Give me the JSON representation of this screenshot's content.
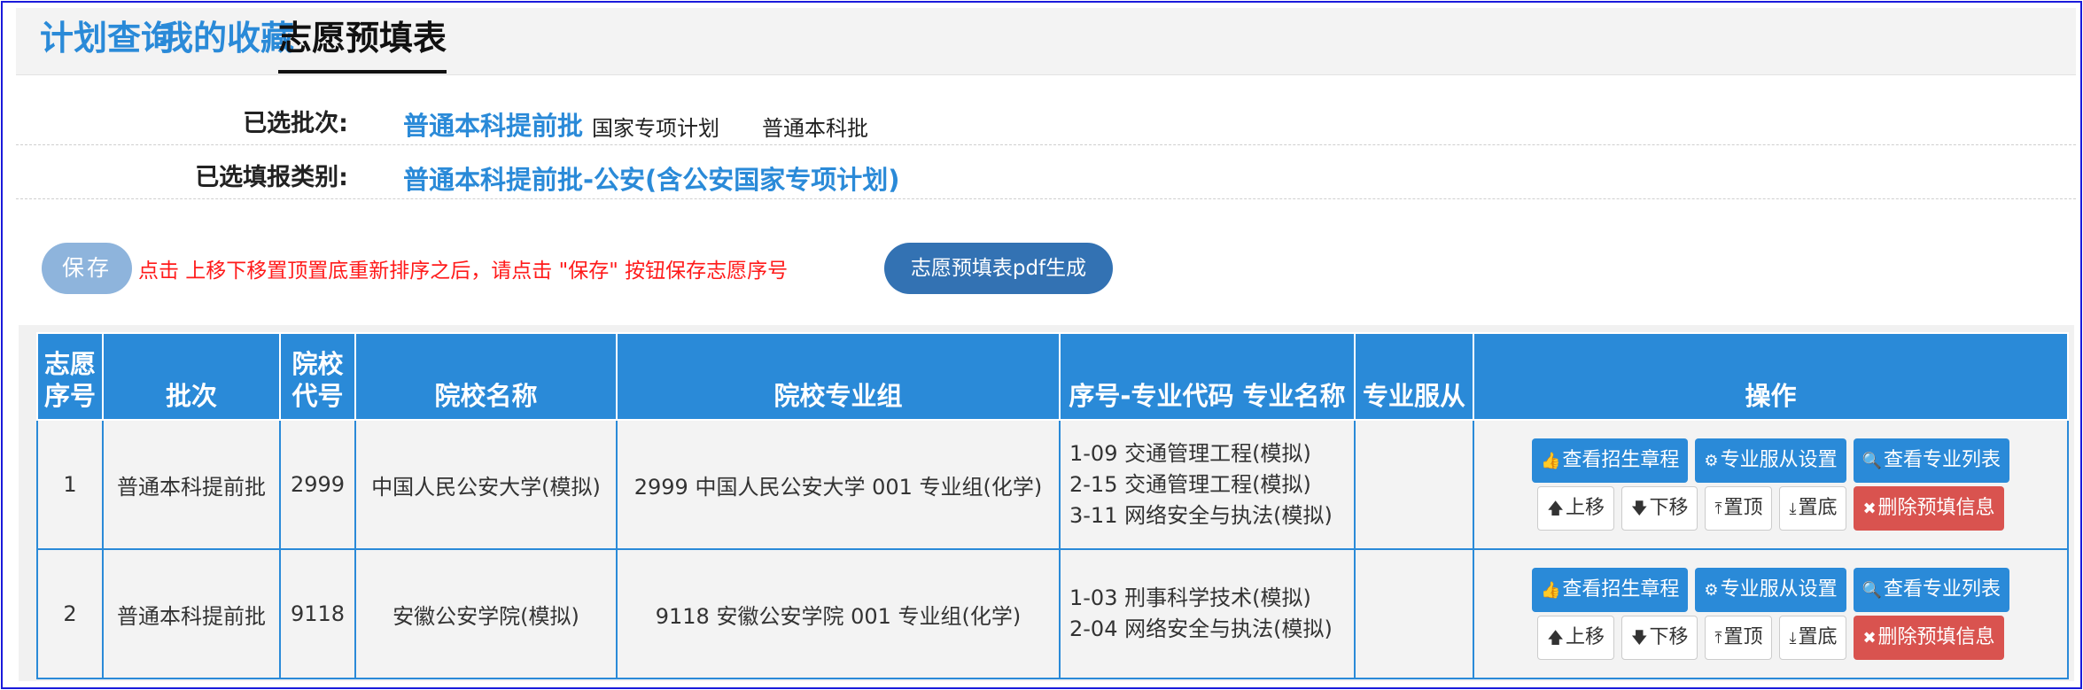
{
  "tabs": [
    {
      "label": "计划查询"
    },
    {
      "label": "我的收藏"
    },
    {
      "label": "志愿预填表"
    }
  ],
  "info": {
    "batch_label": "已选批次:",
    "batches": [
      "普通本科提前批",
      "国家专项计划",
      "普通本科批"
    ],
    "category_label": "已选填报类别:",
    "category_value": "普通本科提前批-公安(含公安国家专项计划)"
  },
  "toolbar": {
    "save_label": "保存",
    "hint": "点击 上移下移置顶置底重新排序之后，请点击 \"保存\" 按钮保存志愿序号",
    "pdf_label": "志愿预填表pdf生成"
  },
  "table": {
    "headers": {
      "seq": "志愿序号",
      "batch": "批次",
      "code": "院校代号",
      "name": "院校名称",
      "group": "院校专业组",
      "majors": "序号-专业代码 专业名称",
      "obey": "专业服从",
      "ops": "操作"
    },
    "ops_labels": {
      "charter": "查看招生章程",
      "obey_setting": "专业服从设置",
      "major_list": "查看专业列表",
      "up": "上移",
      "down": "下移",
      "top": "置顶",
      "bottom": "置底",
      "delete": "删除预填信息"
    },
    "rows": [
      {
        "seq": "1",
        "batch": "普通本科提前批",
        "code": "2999",
        "name": "中国人民公安大学(模拟)",
        "group": "2999 中国人民公安大学 001 专业组(化学)",
        "majors": [
          "1-09 交通管理工程(模拟)",
          "2-15 交通管理工程(模拟)",
          "3-11 网络安全与执法(模拟)"
        ],
        "obey": ""
      },
      {
        "seq": "2",
        "batch": "普通本科提前批",
        "code": "9118",
        "name": "安徽公安学院(模拟)",
        "group": "9118 安徽公安学院 001 专业组(化学)",
        "majors": [
          "1-03 刑事科学技术(模拟)",
          "2-04 网络安全与执法(模拟)"
        ],
        "obey": ""
      }
    ]
  },
  "colors": {
    "accent": "#2a8ad8",
    "danger": "#d9534f",
    "hint": "#ff1a1a",
    "pdf": "#3372b3",
    "save": "#8eb4dc"
  }
}
